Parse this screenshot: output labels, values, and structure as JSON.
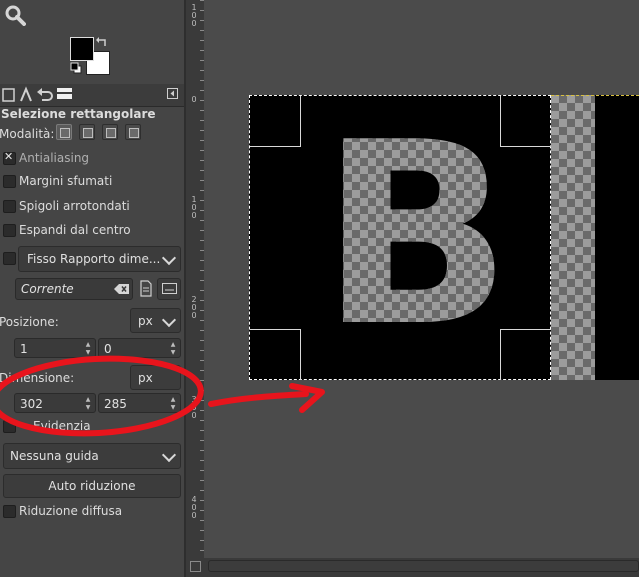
{
  "tool_options": {
    "title": "Selezione rettangolare",
    "mode_label": "Modalità:",
    "antialiasing_label": "Antialiasing",
    "antialiasing_checked": true,
    "feather_label": "Margini sfumati",
    "feather_checked": false,
    "rounded_label": "Spigoli arrotondati",
    "rounded_checked": false,
    "expand_label": "Espandi dal centro",
    "expand_checked": false,
    "fixed_checked": false,
    "fixed_value": "Fisso Rapporto dime...",
    "ratio_value": "Corrente",
    "position_label": "Posizione:",
    "position_unit": "px",
    "position_x": "1",
    "position_y": "0",
    "size_label": "Dimensione:",
    "size_unit": "px",
    "size_w": "302",
    "size_h": "285",
    "highlight_label": "Evidenzia",
    "highlight_checked": false,
    "guides_value": "Nessuna guida",
    "autoshrink_label": "Auto riduzione",
    "shrink_merged_label": "Riduzione diffusa",
    "shrink_merged_checked": false
  },
  "ruler": {
    "labels": [
      "1\n0\n0",
      "0",
      "1\n0\n0",
      "2\n0\n0",
      "3\n0\n0",
      "4\n0\n0"
    ]
  },
  "canvas": {
    "letter": "B"
  },
  "colors": {
    "background": "#454545",
    "annotation": "#e8141c"
  },
  "icons": [
    "zoom-icon",
    "swap-colors-icon",
    "default-colors-icon",
    "tool-options-tab-icon",
    "device-status-tab-icon",
    "undo-history-tab-icon",
    "images-tab-icon",
    "panel-menu-icon",
    "clear-icon",
    "swap-ratio-icon",
    "highlight-preview-icon"
  ]
}
